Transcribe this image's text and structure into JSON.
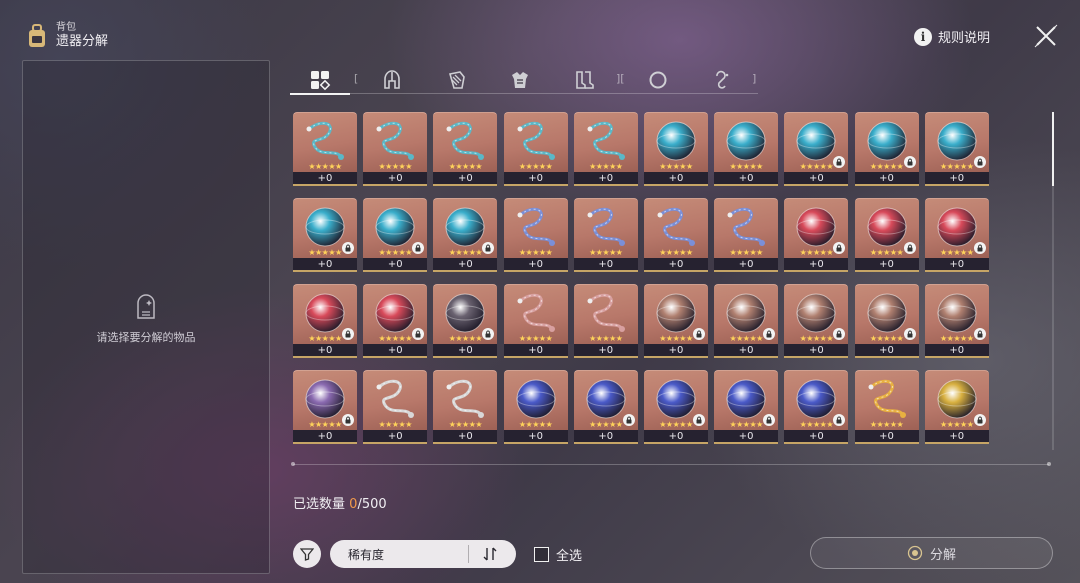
{
  "header": {
    "breadcrumb": "背包",
    "title": "遗器分解"
  },
  "rules_label": "规则说明",
  "left_panel": {
    "placeholder": "请选择要分解的物品"
  },
  "tabs": [
    {
      "icon": "all-items-icon",
      "active": true
    },
    {
      "icon": "helmet-icon",
      "active": false
    },
    {
      "icon": "gloves-icon",
      "active": false
    },
    {
      "icon": "body-armor-icon",
      "active": false
    },
    {
      "icon": "boots-icon",
      "active": false
    },
    {
      "icon": "sphere-icon",
      "active": false
    },
    {
      "icon": "rope-icon",
      "active": false
    }
  ],
  "items": [
    {
      "type": "rope",
      "color": "#5ab8c8",
      "level": "+0",
      "locked": false
    },
    {
      "type": "rope",
      "color": "#5ab8c8",
      "level": "+0",
      "locked": false
    },
    {
      "type": "rope",
      "color": "#5ab8c8",
      "level": "+0",
      "locked": false
    },
    {
      "type": "rope",
      "color": "#5ab8c8",
      "level": "+0",
      "locked": false
    },
    {
      "type": "rope",
      "color": "#5ab8c8",
      "level": "+0",
      "locked": false
    },
    {
      "type": "sphere",
      "color": "#3aaecb",
      "level": "+0",
      "locked": false
    },
    {
      "type": "sphere",
      "color": "#3aaecb",
      "level": "+0",
      "locked": false
    },
    {
      "type": "sphere",
      "color": "#3aaecb",
      "level": "+0",
      "locked": true
    },
    {
      "type": "sphere",
      "color": "#3aaecb",
      "level": "+0",
      "locked": true
    },
    {
      "type": "sphere",
      "color": "#3aaecb",
      "level": "+0",
      "locked": true
    },
    {
      "type": "sphere",
      "color": "#3aaecb",
      "level": "+0",
      "locked": true
    },
    {
      "type": "sphere",
      "color": "#3aaecb",
      "level": "+0",
      "locked": true
    },
    {
      "type": "sphere",
      "color": "#3aaecb",
      "level": "+0",
      "locked": true
    },
    {
      "type": "rope",
      "color": "#7a8fd8",
      "level": "+0",
      "locked": false
    },
    {
      "type": "rope",
      "color": "#7a8fd8",
      "level": "+0",
      "locked": false
    },
    {
      "type": "rope",
      "color": "#7a8fd8",
      "level": "+0",
      "locked": false
    },
    {
      "type": "rope",
      "color": "#7a8fd8",
      "level": "+0",
      "locked": false
    },
    {
      "type": "sphere",
      "color": "#d84a5a",
      "level": "+0",
      "locked": true
    },
    {
      "type": "sphere",
      "color": "#d84a5a",
      "level": "+0",
      "locked": true
    },
    {
      "type": "sphere",
      "color": "#d84a5a",
      "level": "+0",
      "locked": true
    },
    {
      "type": "sphere",
      "color": "#d84a5a",
      "level": "+0",
      "locked": true
    },
    {
      "type": "sphere",
      "color": "#d84a5a",
      "level": "+0",
      "locked": true
    },
    {
      "type": "sphere",
      "color": "#6a6270",
      "level": "+0",
      "locked": true
    },
    {
      "type": "rope",
      "color": "#d8a0a0",
      "level": "+0",
      "locked": false
    },
    {
      "type": "rope",
      "color": "#d8a0a0",
      "level": "+0",
      "locked": false
    },
    {
      "type": "sphere",
      "color": "#b08070",
      "level": "+0",
      "locked": true
    },
    {
      "type": "sphere",
      "color": "#b08070",
      "level": "+0",
      "locked": true
    },
    {
      "type": "sphere",
      "color": "#b08070",
      "level": "+0",
      "locked": true
    },
    {
      "type": "sphere",
      "color": "#b08070",
      "level": "+0",
      "locked": true
    },
    {
      "type": "sphere",
      "color": "#b08070",
      "level": "+0",
      "locked": true
    },
    {
      "type": "sphere",
      "color": "#8a6ab0",
      "level": "+0",
      "locked": true
    },
    {
      "type": "rope",
      "color": "#d8d8d8",
      "level": "+0",
      "locked": false
    },
    {
      "type": "rope",
      "color": "#d8d8d8",
      "level": "+0",
      "locked": false
    },
    {
      "type": "sphere",
      "color": "#4a5ac8",
      "level": "+0",
      "locked": false
    },
    {
      "type": "sphere",
      "color": "#4a5ac8",
      "level": "+0",
      "locked": true
    },
    {
      "type": "sphere",
      "color": "#4a5ac8",
      "level": "+0",
      "locked": true
    },
    {
      "type": "sphere",
      "color": "#4a5ac8",
      "level": "+0",
      "locked": true
    },
    {
      "type": "sphere",
      "color": "#4a5ac8",
      "level": "+0",
      "locked": true
    },
    {
      "type": "rope",
      "color": "#e8b040",
      "level": "+0",
      "locked": false
    },
    {
      "type": "sphere",
      "color": "#d8b040",
      "level": "+0",
      "locked": true
    }
  ],
  "stars": "★★★★★",
  "selection": {
    "label": "已选数量",
    "selected": "0",
    "max": "/500"
  },
  "sort": {
    "value": "稀有度"
  },
  "select_all_label": "全选",
  "decompose_label": "分解"
}
